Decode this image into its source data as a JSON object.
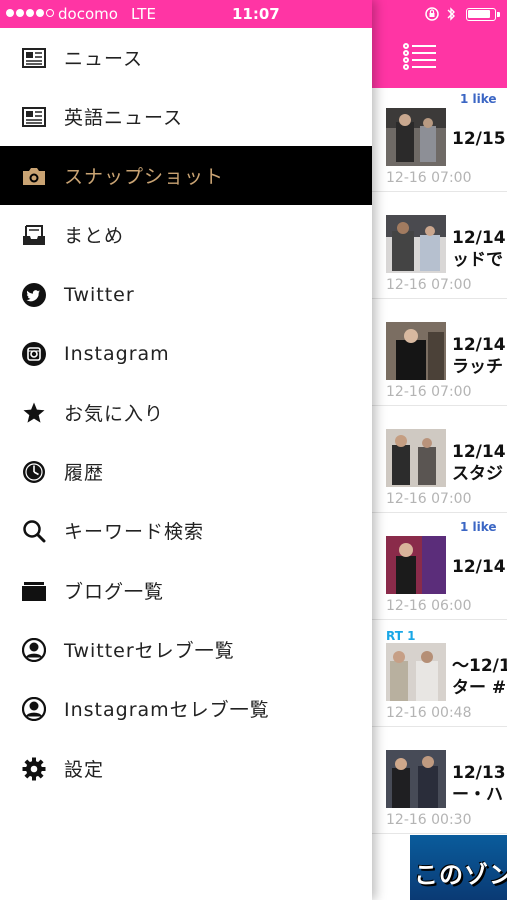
{
  "status_bar": {
    "carrier": "docomo",
    "network": "LTE",
    "time": "11:07"
  },
  "menu": {
    "items": [
      {
        "label": "ニュース",
        "icon": "newspaper-icon"
      },
      {
        "label": "英語ニュース",
        "icon": "newspaper-icon"
      },
      {
        "label": "スナップショット",
        "icon": "camera-icon",
        "active": true
      },
      {
        "label": "まとめ",
        "icon": "inbox-tray-icon"
      },
      {
        "label": "Twitter",
        "icon": "twitter-bird-icon"
      },
      {
        "label": "Instagram",
        "icon": "instagram-camera-icon"
      },
      {
        "label": "お気に入り",
        "icon": "star-icon"
      },
      {
        "label": "履歴",
        "icon": "clock-icon"
      },
      {
        "label": "キーワード検索",
        "icon": "search-icon"
      },
      {
        "label": "ブログ一覧",
        "icon": "folder-icon"
      },
      {
        "label": "Twitterセレブ一覧",
        "icon": "user-icon"
      },
      {
        "label": "Instagramセレブ一覧",
        "icon": "user-icon"
      },
      {
        "label": "設定",
        "icon": "gear-icon"
      }
    ]
  },
  "articles": [
    {
      "badge": "1 like",
      "title": "12/15",
      "time": "12-16 07:00"
    },
    {
      "title": "12/14\nッドで",
      "time": "12-16 07:00"
    },
    {
      "title": "12/14\nラッチ",
      "time": "12-16 07:00"
    },
    {
      "title": "12/14\nスタジ",
      "time": "12-16 07:00"
    },
    {
      "badge": "1 like",
      "title": "12/14",
      "time": "12-16 06:00"
    },
    {
      "rt": "RT 1",
      "title": "〜12/1\nター #",
      "time": "12-16 00:48"
    },
    {
      "title": "12/13\nー・ハ",
      "time": "12-16 00:30"
    }
  ],
  "ad": {
    "text": "このゾン"
  },
  "colors": {
    "header_pink": "#ff35a4",
    "active_bg": "#000000",
    "active_text": "#c9a373",
    "timestamp": "#b4b4b4",
    "like_blue": "#3b66c4",
    "rt_blue": "#19a7e6"
  }
}
